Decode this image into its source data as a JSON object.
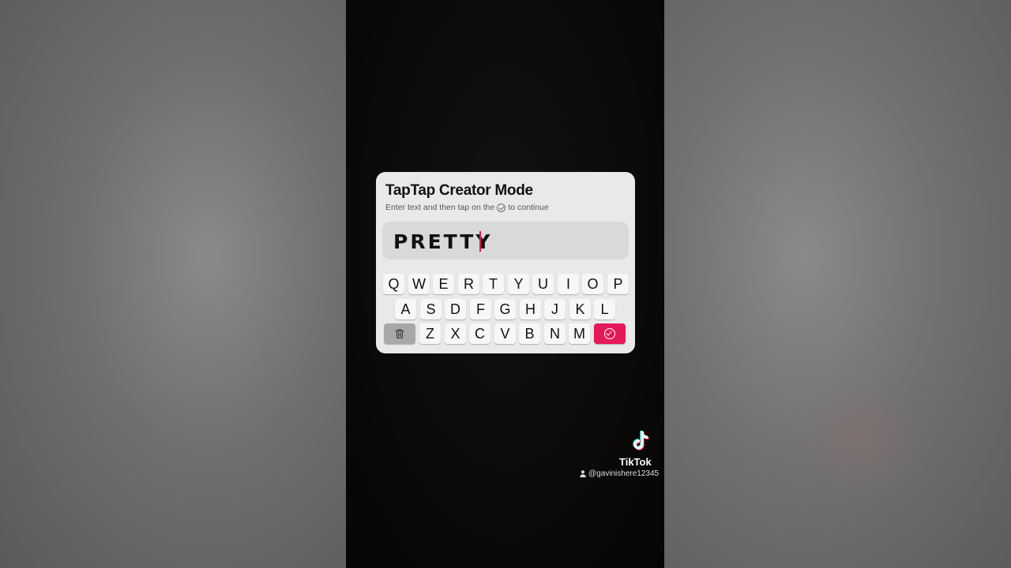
{
  "dialog": {
    "title": "TapTap Creator Mode",
    "subtitle_before": "Enter text and then tap on the",
    "subtitle_after": "to continue",
    "input_value": "PRETTY"
  },
  "keyboard": {
    "row1": [
      "Q",
      "W",
      "E",
      "R",
      "T",
      "Y",
      "U",
      "I",
      "O",
      "P"
    ],
    "row2": [
      "A",
      "S",
      "D",
      "F",
      "G",
      "H",
      "J",
      "K",
      "L"
    ],
    "row3": [
      "Z",
      "X",
      "C",
      "V",
      "B",
      "N",
      "M"
    ],
    "delete_icon": "trash-icon",
    "submit_icon": "check-circle-icon",
    "submit_color": "#e5195a"
  },
  "watermark": {
    "brand": "TikTok",
    "handle": "@gavinishere12345"
  }
}
